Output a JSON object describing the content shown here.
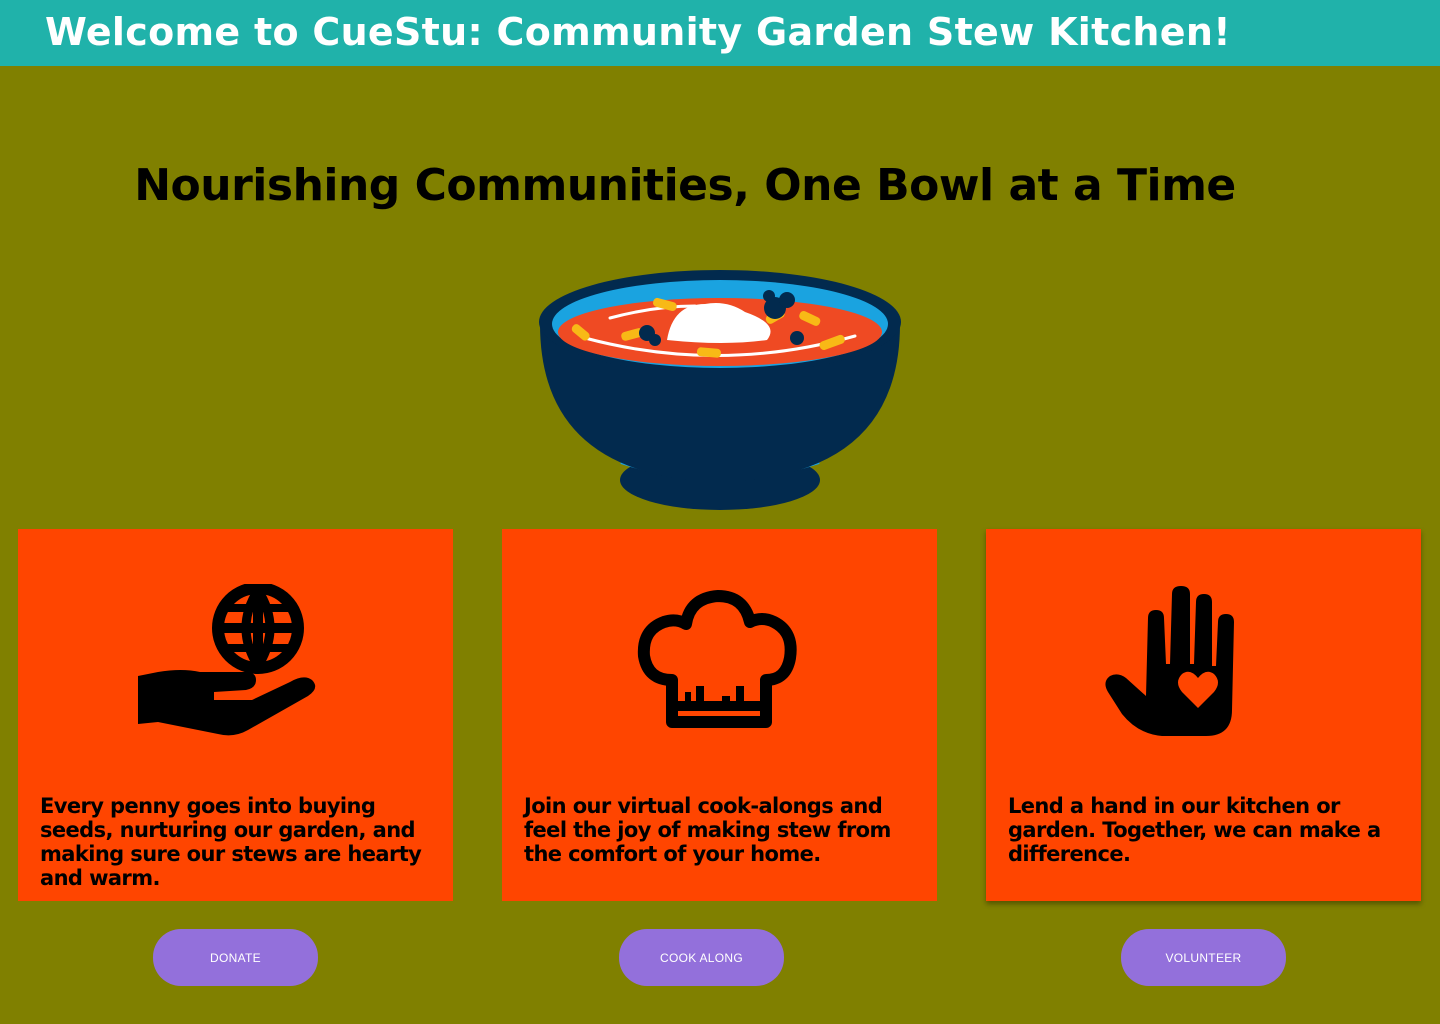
{
  "header": {
    "title": "Welcome to CueStu: Community Garden Stew Kitchen!",
    "background_color": "#20b2aa"
  },
  "hero": {
    "headline": "Nourishing Communities, One Bowl at a Time",
    "image_icon": "stew-bowl-icon"
  },
  "page_background_color": "#808000",
  "cards": [
    {
      "icon": "hand-holding-globe-icon",
      "text": "Every penny goes into buying seeds, nurturing our garden, and making sure our stews are hearty and warm.",
      "button_label": "DONATE"
    },
    {
      "icon": "chef-hat-icon",
      "text": "Join our virtual cook-alongs and feel the joy of making stew from the comfort of your home.",
      "button_label": "COOK ALONG"
    },
    {
      "icon": "hand-heart-icon",
      "text": "Lend a hand in our kitchen or garden. Together, we can make a difference.",
      "button_label": "VOLUNTEER"
    }
  ],
  "colors": {
    "card_background": "#ff4500",
    "button_background": "#9370db",
    "button_text": "#ffffff"
  }
}
